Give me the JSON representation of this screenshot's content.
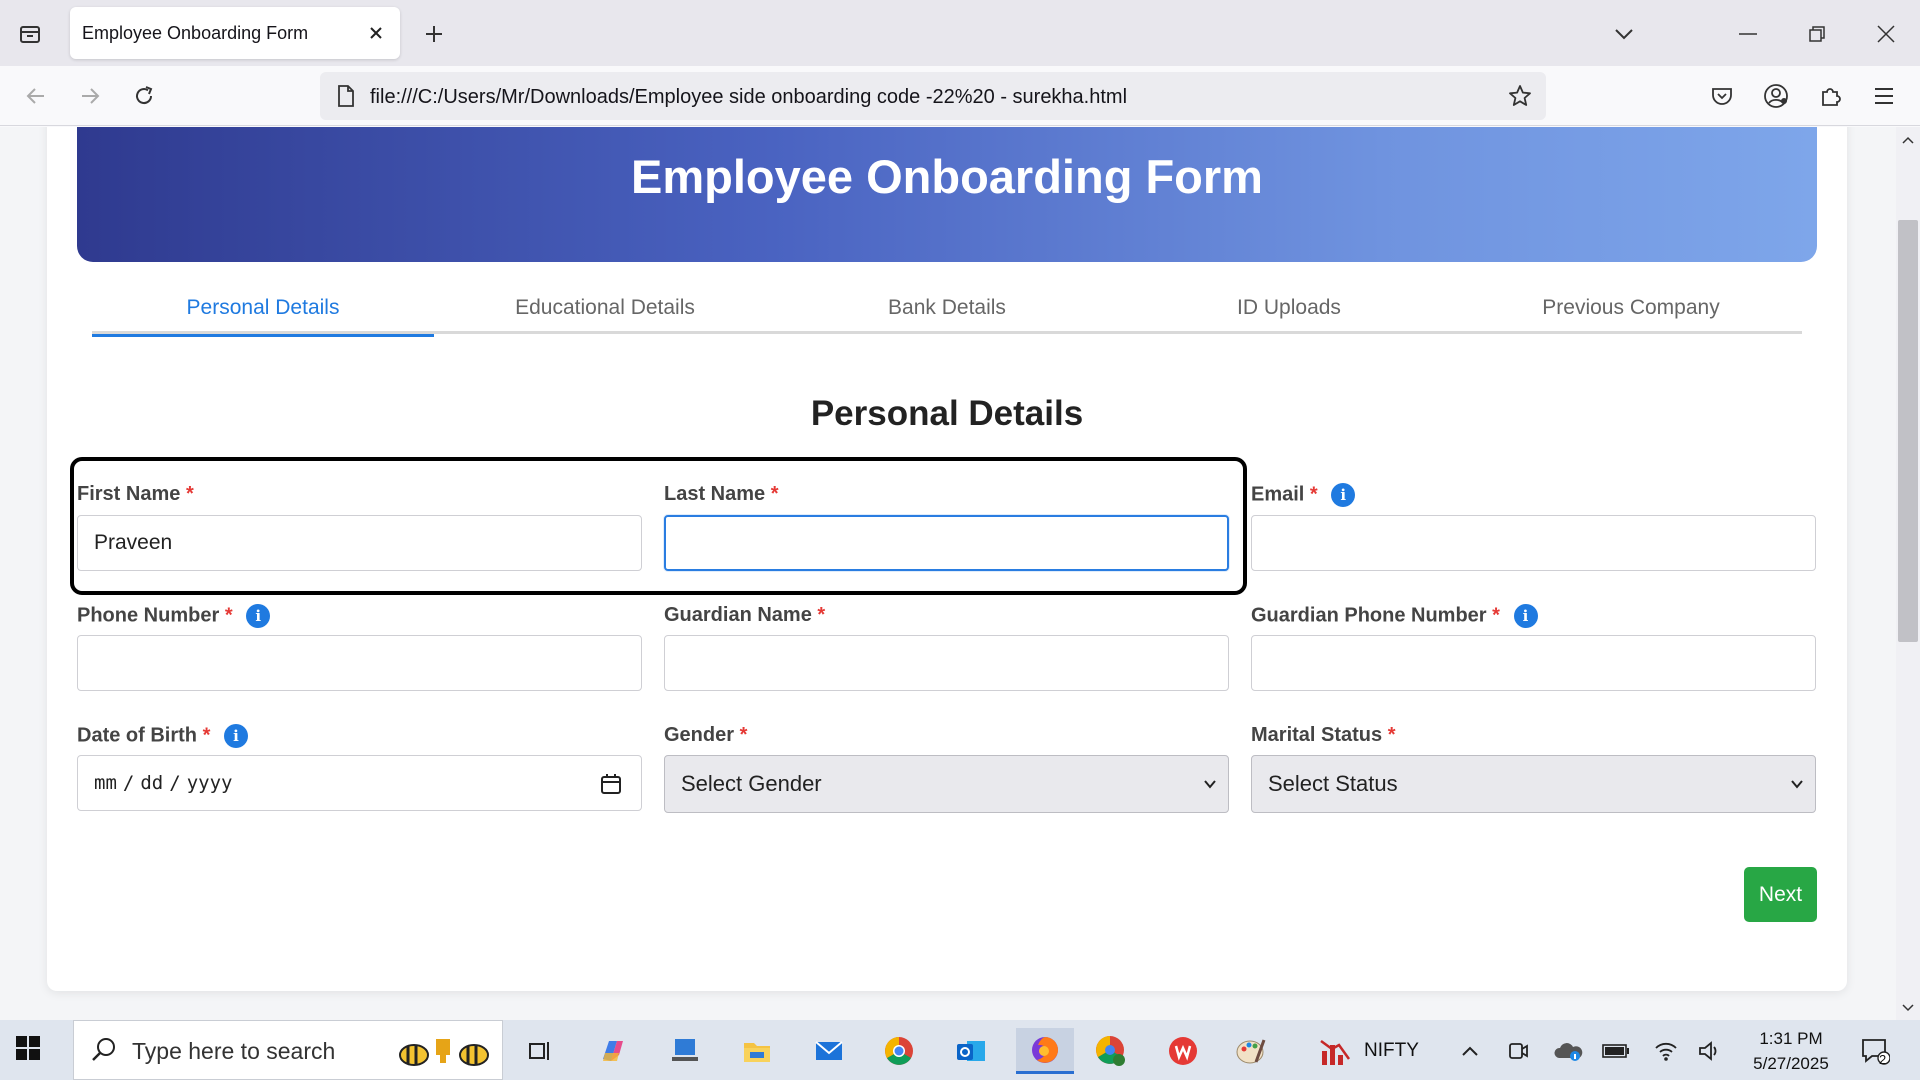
{
  "browser": {
    "tab_title": "Employee Onboarding Form",
    "url": "file:///C:/Users/Mr/Downloads/Employee side onboarding code -22%20 - surekha.html"
  },
  "form": {
    "header_title": "Employee Onboarding Form",
    "tabs": [
      "Personal Details",
      "Educational Details",
      "Bank Details",
      "ID Uploads",
      "Previous Company"
    ],
    "active_tab": "Personal Details",
    "section_title": "Personal Details",
    "required_mark": "*",
    "info_glyph": "i",
    "fields": {
      "first_name": {
        "label": "First Name",
        "value": "Praveen"
      },
      "last_name": {
        "label": "Last Name",
        "value": ""
      },
      "email": {
        "label": "Email",
        "value": ""
      },
      "phone": {
        "label": "Phone Number",
        "value": ""
      },
      "guardian_name": {
        "label": "Guardian Name",
        "value": ""
      },
      "guardian_phone": {
        "label": "Guardian Phone Number",
        "value": ""
      },
      "dob": {
        "label": "Date of Birth",
        "mm": "mm",
        "dd": "dd",
        "yyyy": "yyyy",
        "sep": "/"
      },
      "gender": {
        "label": "Gender",
        "selected": "Select Gender"
      },
      "marital_status": {
        "label": "Marital Status",
        "selected": "Select Status"
      }
    },
    "next_label": "Next"
  },
  "taskbar": {
    "search_placeholder": "Type here to search",
    "nifty_label": "NIFTY",
    "time": "1:31 PM",
    "date": "5/27/2025",
    "notification_count": "2"
  },
  "colors": {
    "accent": "#1f7ae0",
    "required": "#e53935",
    "next_button": "#28a745",
    "header_gradient_start": "#2f3a8f",
    "header_gradient_end": "#7ea6ea"
  }
}
